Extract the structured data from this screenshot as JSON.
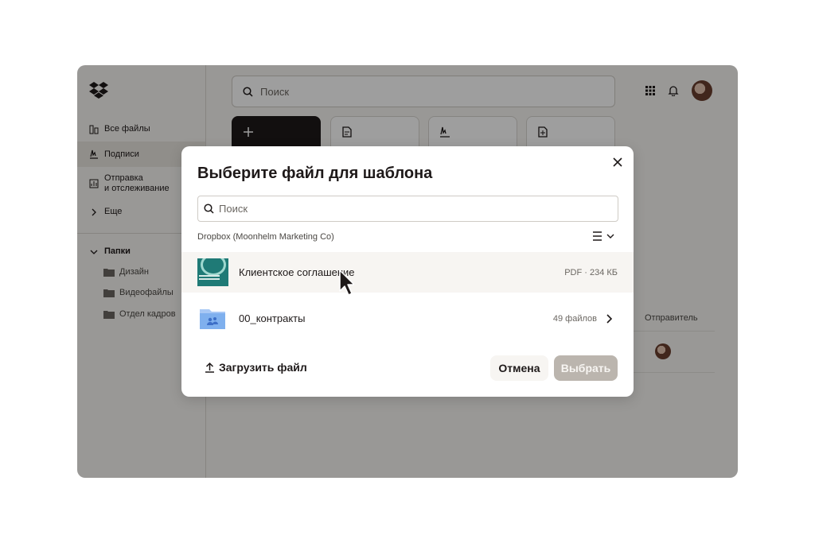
{
  "app": {
    "sidebar": {
      "items": [
        {
          "label": "Все файлы",
          "icon": "files-icon"
        },
        {
          "label": "Подписи",
          "icon": "signature-icon"
        },
        {
          "label": "Отправка\nи отслеживание",
          "icon": "tracking-icon"
        },
        {
          "label": "Еще",
          "icon": "chevron-right-icon"
        }
      ],
      "folders_header": "Папки",
      "folders": [
        "Дизайн",
        "Видеофайлы",
        "Отдел кадров"
      ]
    },
    "search_placeholder": "Поиск",
    "column_sender": "Отправитель"
  },
  "modal": {
    "title": "Выберите файл для шаблона",
    "search_placeholder": "Поиск",
    "path": "Dropbox (Moonhelm Marketing Co)",
    "files": [
      {
        "name": "Клиентское соглашение",
        "meta": "PDF · 234 КБ",
        "type": "pdf"
      },
      {
        "name": "00_контракты",
        "meta": "49 файлов",
        "type": "folder"
      }
    ],
    "upload_label": "Загрузить файл",
    "cancel_label": "Отмена",
    "choose_label": "Выбрать"
  },
  "colors": {
    "primary_dark": "#1e1919",
    "background_warm": "#f7f5f2",
    "disabled_button": "#bbb5ae",
    "thumbnail_teal": "#1f7a76"
  }
}
